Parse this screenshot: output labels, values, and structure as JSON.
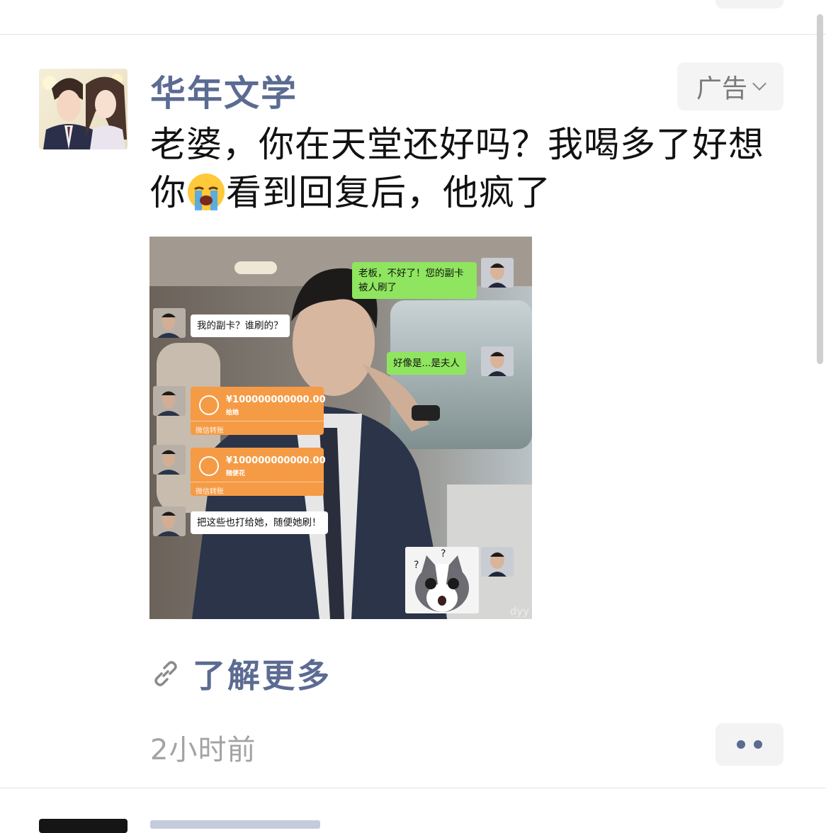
{
  "post": {
    "author": "华年文学",
    "ad_label": "广告",
    "text_before_emoji": "老婆，你在天堂还好吗？我喝多了好想你",
    "text_after_emoji": "看到回复后，他疯了",
    "learn_more": "了解更多",
    "timestamp": "2小时前"
  },
  "image": {
    "messages": {
      "m1": "老板，不好了！您的副卡被人刷了",
      "m2": "我的副卡？谁刷的？",
      "m3": "好像是...是夫人",
      "m4": "把这些也打给她，随便她刷！"
    },
    "transfers": [
      {
        "amount": "¥100000000000.00",
        "note": "给她",
        "footer": "微信转账"
      },
      {
        "amount": "¥100000000000.00",
        "note": "随便花",
        "footer": "微信转账"
      }
    ],
    "watermark": "dyy"
  },
  "icons": {
    "ad_dropdown": "chevron-down-icon",
    "learn_more": "link-icon",
    "more": "more-dots-icon",
    "emoji": "loudly-crying-face-emoji",
    "transfer": "transfer-arrows-icon"
  },
  "colors": {
    "accent": "#5b6b92",
    "ad_bg": "#f4f4f4",
    "timestamp": "#a3a3a3",
    "bubble_green": "#8fe55f",
    "transfer_orange": "#f59b45"
  }
}
